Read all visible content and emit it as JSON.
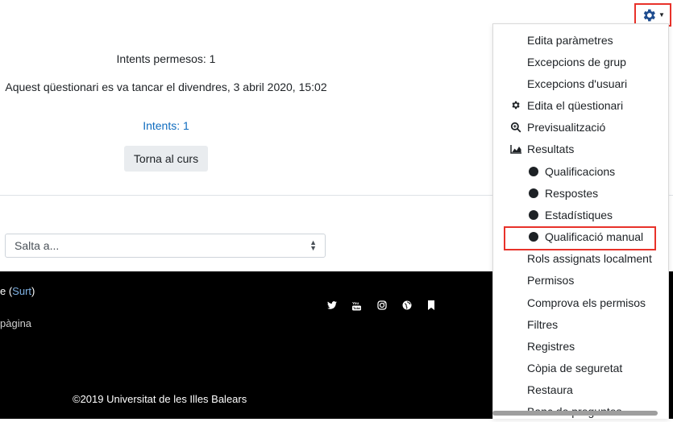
{
  "quiz": {
    "attempts_allowed": "Intents permesos: 1",
    "closed_info": "Aquest qüestionari es va tancar el divendres, 3 abril 2020, 15:02",
    "attempts_link": "Intents: 1",
    "back_button": "Torna al curs"
  },
  "jump": {
    "selected": "Salta a..."
  },
  "footer": {
    "login_prefix": "e (",
    "logout_link": "Surt",
    "login_suffix": ")",
    "page_text": "pàgina",
    "copyright": "©2019 Universitat de les Illes Balears",
    "social_icons": [
      "twitter-icon",
      "youtube-icon",
      "instagram-icon",
      "globe-icon",
      "bookmark-icon"
    ]
  },
  "settings_menu": {
    "accent_color": "#e8322a",
    "items": [
      {
        "label": "Edita paràmetres",
        "icon": ""
      },
      {
        "label": "Excepcions de grup",
        "icon": ""
      },
      {
        "label": "Excepcions d'usuari",
        "icon": ""
      },
      {
        "label": "Edita el qüestionari",
        "icon": "gear-icon"
      },
      {
        "label": "Previsualització",
        "icon": "magnifier-icon"
      },
      {
        "label": "Resultats",
        "icon": "chart-icon"
      },
      {
        "label": "Qualificacions",
        "icon": "bullet"
      },
      {
        "label": "Respostes",
        "icon": "bullet"
      },
      {
        "label": "Estadístiques",
        "icon": "bullet"
      },
      {
        "label": "Qualificació manual",
        "icon": "bullet"
      },
      {
        "label": "Rols assignats localment",
        "icon": ""
      },
      {
        "label": "Permisos",
        "icon": ""
      },
      {
        "label": "Comprova els permisos",
        "icon": ""
      },
      {
        "label": "Filtres",
        "icon": ""
      },
      {
        "label": "Registres",
        "icon": ""
      },
      {
        "label": "Còpia de seguretat",
        "icon": ""
      },
      {
        "label": "Restaura",
        "icon": ""
      },
      {
        "label": "Banc de preguntes",
        "icon": ""
      }
    ]
  }
}
